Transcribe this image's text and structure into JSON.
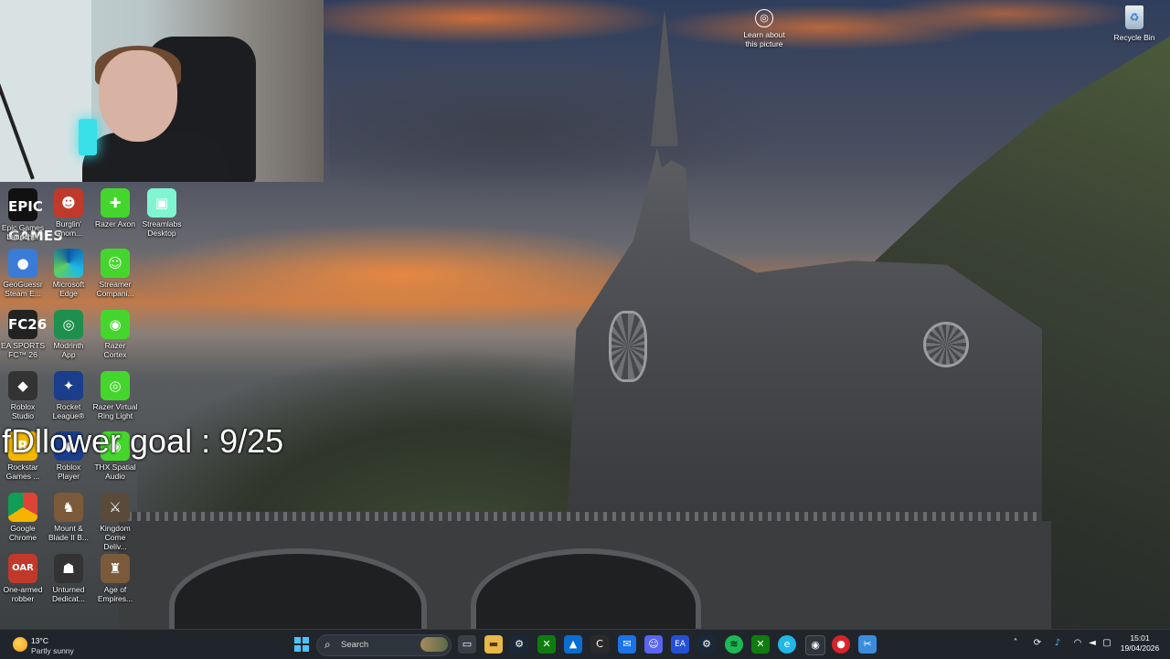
{
  "overlay": {
    "follower_goal": "fDllower goal : 9/25"
  },
  "desktop": {
    "learn_about_picture": "Learn about this picture",
    "recycle_bin": "Recycle Bin",
    "icons": [
      {
        "label": "Epic Games Launcher",
        "icon": "epic-games-icon",
        "glyph": "EPIC GAMES"
      },
      {
        "label": "Burglin' Gnom...",
        "icon": "burglin-gnomes-icon",
        "glyph": "☻"
      },
      {
        "label": "Razer Axon",
        "icon": "razer-axon-icon",
        "glyph": "✚"
      },
      {
        "label": "Streamlabs Desktop",
        "icon": "streamlabs-icon",
        "glyph": "▣"
      },
      {
        "label": "GeoGuessr Steam E...",
        "icon": "geoguessr-icon",
        "glyph": "●"
      },
      {
        "label": "Microsoft Edge",
        "icon": "edge-icon",
        "glyph": ""
      },
      {
        "label": "Streamer Compani...",
        "icon": "streamer-companion-icon",
        "glyph": "☺"
      },
      {
        "label": "EA SPORTS FC™ 26",
        "icon": "ea-fc-icon",
        "glyph": "FC26"
      },
      {
        "label": "Modrinth App",
        "icon": "modrinth-icon",
        "glyph": "◎"
      },
      {
        "label": "Razer Cortex",
        "icon": "razer-cortex-icon",
        "glyph": "◉"
      },
      {
        "label": "Roblox Studio",
        "icon": "roblox-studio-icon",
        "glyph": "◆"
      },
      {
        "label": "Rocket League®",
        "icon": "rocket-league-icon",
        "glyph": "✦"
      },
      {
        "label": "Razer Virtual Ring Light",
        "icon": "razer-ring-light-icon",
        "glyph": "◎"
      },
      {
        "label": "Rockstar Games ...",
        "icon": "rockstar-icon",
        "glyph": "R"
      },
      {
        "label": "Roblox Player",
        "icon": "roblox-player-icon",
        "glyph": "◆"
      },
      {
        "label": "THX Spatial Audio",
        "icon": "thx-icon",
        "glyph": "◉"
      },
      {
        "label": "Google Chrome",
        "icon": "chrome-icon",
        "glyph": ""
      },
      {
        "label": "Mount & Blade II B...",
        "icon": "mount-blade-icon",
        "glyph": "♞"
      },
      {
        "label": "Kingdom Come Deliv...",
        "icon": "kingdom-come-icon",
        "glyph": "⚔"
      },
      {
        "label": "One-armed robber",
        "icon": "one-armed-robber-icon",
        "glyph": "OAR"
      },
      {
        "label": "Unturned Dedicat...",
        "icon": "unturned-icon",
        "glyph": "☗"
      },
      {
        "label": "Age of Empires...",
        "icon": "age-of-empires-icon",
        "glyph": "♜"
      }
    ]
  },
  "taskbar": {
    "weather": {
      "temp": "13°C",
      "condition": "Partly sunny"
    },
    "search_label": "Search",
    "clock": {
      "time": "15:01",
      "date": "19/04/2026"
    }
  },
  "colors": {
    "taskbar_bg": "#20252b",
    "windows_accent": "#4cc2ff",
    "razer_green": "#44d62c"
  }
}
